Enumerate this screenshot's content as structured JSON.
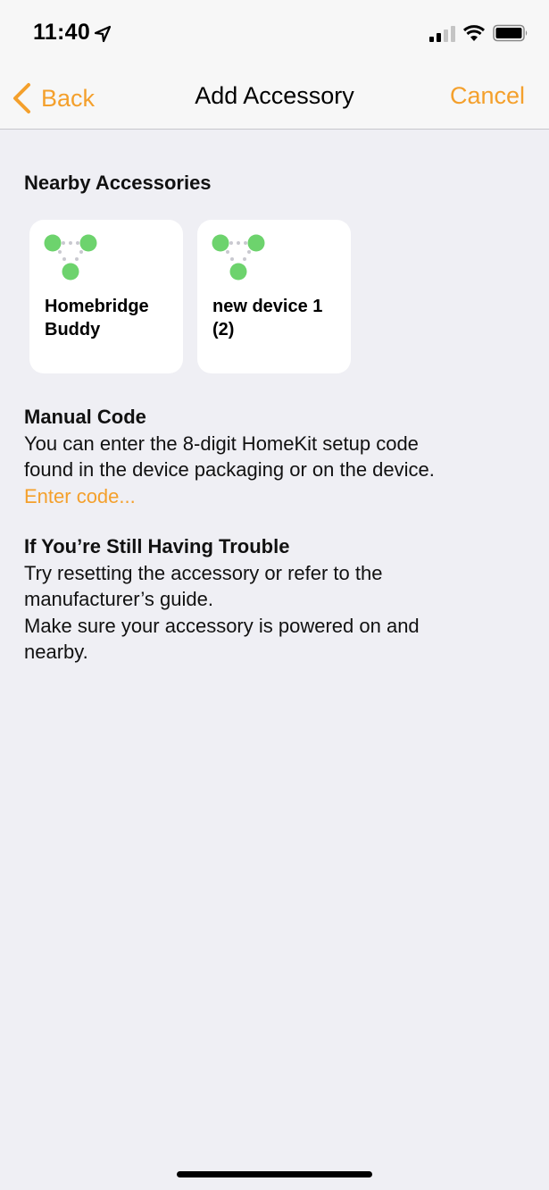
{
  "status_bar": {
    "time": "11:40",
    "icons": [
      "location-arrow-icon",
      "cellular-signal-icon",
      "wifi-icon",
      "battery-icon"
    ]
  },
  "nav": {
    "back_label": "Back",
    "title": "Add Accessory",
    "cancel_label": "Cancel",
    "accent_color": "#f4a02c"
  },
  "nearby": {
    "title": "Nearby Accessories",
    "accessories": [
      {
        "name_line1": "Homebridge",
        "name_line2": "Buddy",
        "icon": "homekit-bridge-icon"
      },
      {
        "name_line1": "new device 1",
        "name_line2": "(2)",
        "icon": "homekit-bridge-icon"
      }
    ]
  },
  "manual_code": {
    "title": "Manual Code",
    "line1": "You can enter the 8-digit HomeKit setup code",
    "line2": "found in the device packaging or on the device.",
    "link": "Enter code..."
  },
  "trouble": {
    "title": "If You’re Still Having Trouble",
    "line1": "Try resetting the accessory or refer to the",
    "line2": "manufacturer’s guide.",
    "line3": "Make sure your accessory is powered on and",
    "line4": "nearby."
  }
}
